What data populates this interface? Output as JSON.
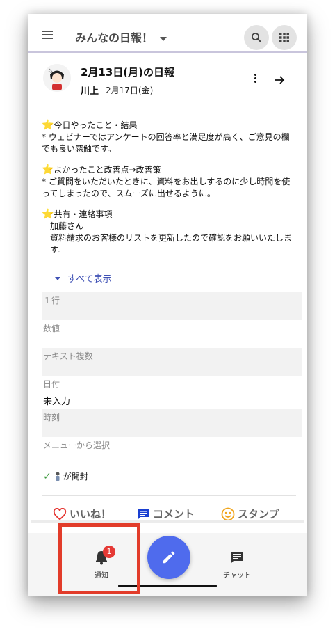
{
  "app": {
    "title": "みんなの日報！"
  },
  "report": {
    "title": "2月13日(月)の日報",
    "author": "川上",
    "date": "2月17日(金)",
    "sections": [
      {
        "heading": "今日やったこと・結果",
        "lines": [
          "* ウェビナーではアンケートの回答率と満足度が高く、ご意見の欄でも良い感触です。"
        ]
      },
      {
        "heading": "よかったこと改善点→改善策",
        "lines": [
          "* ご質問をいただいたときに、資料をお出しするのに少し時間を使ってしまったので、スムーズに出せるように。"
        ]
      },
      {
        "heading": "共有・連絡事項",
        "lines": [
          "加藤さん",
          "資料請求のお客様のリストを更新したので確認をお願いいたします。"
        ]
      }
    ],
    "show_all": "すべて表示",
    "fields": [
      {
        "label": "１行",
        "value": ""
      },
      {
        "label": "数値",
        "value": ""
      },
      {
        "label": "テキスト複数",
        "value": ""
      },
      {
        "label": "日付",
        "value": "未入力"
      },
      {
        "label": "時刻",
        "value": ""
      },
      {
        "label": "メニューから選択",
        "value": ""
      }
    ],
    "read_status": "が開封"
  },
  "actions": {
    "like": "いいね！",
    "comment": "コメント",
    "stamp": "スタンプ"
  },
  "bottom_nav": {
    "notify_label": "通知",
    "notify_badge": "1",
    "chat_label": "チャット"
  },
  "colors": {
    "accent": "#4f6bed",
    "link": "#3f51b5",
    "badge": "#e53935",
    "highlight": "#e23c2a",
    "like": "#e53935",
    "comment": "#1a3fd1",
    "stamp": "#f1a51b",
    "check": "#3c9a3c"
  },
  "icons": {
    "menu": "menu-icon",
    "search": "search-icon",
    "apps": "apps-grid-icon",
    "more": "more-vert-icon",
    "open": "arrow-right-icon",
    "like": "heart-icon",
    "comment": "comment-icon",
    "stamp": "smiley-icon",
    "notify": "bell-icon",
    "new_post": "pencil-icon",
    "chat": "chat-icon"
  }
}
